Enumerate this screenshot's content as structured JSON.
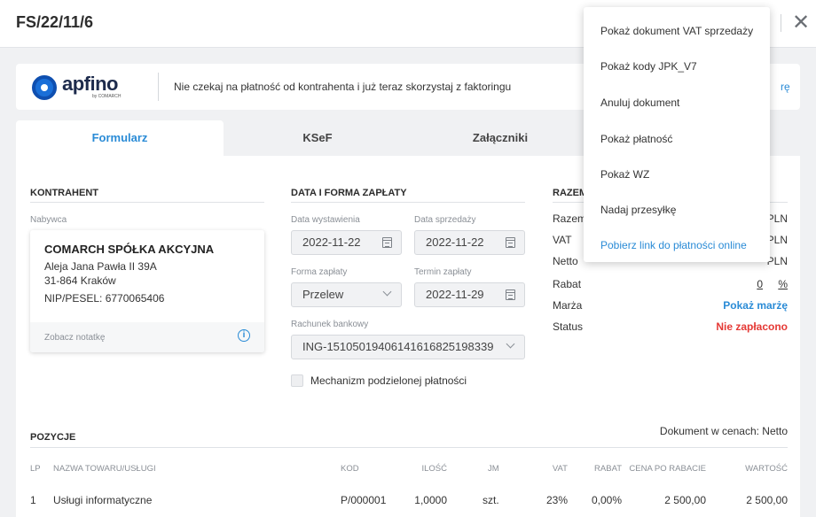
{
  "header": {
    "title": "FS/22/11/6",
    "close_icon": "close-icon"
  },
  "banner": {
    "logo_text": "apfino",
    "logo_sub": "by COMARCH",
    "message": "Nie czekaj na płatność od kontrahenta i już teraz skorzystaj z faktoringu",
    "link_fragment": "rę"
  },
  "tabs": [
    {
      "label": "Formularz",
      "active": true
    },
    {
      "label": "KSeF",
      "active": false
    },
    {
      "label": "Załączniki",
      "active": false
    }
  ],
  "kontrahent": {
    "title": "KONTRAHENT",
    "label": "Nabywca",
    "name": "COMARCH SPÓŁKA AKCYJNA",
    "address1": "Aleja Jana Pawła II 39A",
    "address2": "31-864 Kraków",
    "nip": "NIP/PESEL: 6770065406",
    "note": "Zobacz notatkę"
  },
  "platnosc": {
    "title": "DATA I FORMA ZAPŁATY",
    "issue_label": "Data wystawienia",
    "issue_value": "2022-11-22",
    "sale_label": "Data sprzedaży",
    "sale_value": "2022-11-22",
    "form_label": "Forma zapłaty",
    "form_value": "Przelew",
    "due_label": "Termin zapłaty",
    "due_value": "2022-11-29",
    "account_label": "Rachunek bankowy",
    "account_value": "ING-15105019406141616825198339",
    "split_label": "Mechanizm podzielonej płatności"
  },
  "razem": {
    "title": "RAZEM",
    "rows": [
      {
        "label": "Razem",
        "value": "PLN"
      },
      {
        "label": "VAT",
        "value": "PLN"
      },
      {
        "label": "Netto",
        "value": "PLN"
      }
    ],
    "rabat_label": "Rabat",
    "rabat_value": "0",
    "rabat_unit": "%",
    "marza_label": "Marża",
    "marza_value": "Pokaż marżę",
    "status_label": "Status",
    "status_value": "Nie zapłacono"
  },
  "pozycje": {
    "title": "POZYCJE",
    "price_note": "Dokument w cenach: Netto",
    "columns": [
      "LP",
      "NAZWA TOWARU/USŁUGI",
      "KOD",
      "ILOŚĆ",
      "JM",
      "VAT",
      "RABAT",
      "CENA PO RABACIE",
      "WARTOŚĆ"
    ],
    "rows": [
      [
        "1",
        "Usługi informatyczne",
        "P/000001",
        "1,0000",
        "szt.",
        "23%",
        "0,00%",
        "2 500,00",
        "2 500,00"
      ]
    ]
  },
  "menu": {
    "items": [
      "Pokaż dokument VAT sprzedaży",
      "Pokaż kody JPK_V7",
      "Anuluj dokument",
      "Pokaż płatność",
      "Pokaż WZ",
      "Nadaj przesyłkę",
      "Pobierz link do płatności online"
    ]
  },
  "colors": {
    "accent": "#2a8bd6",
    "status_unpaid": "#e53935",
    "brand_logo": "#1a6fd8"
  }
}
